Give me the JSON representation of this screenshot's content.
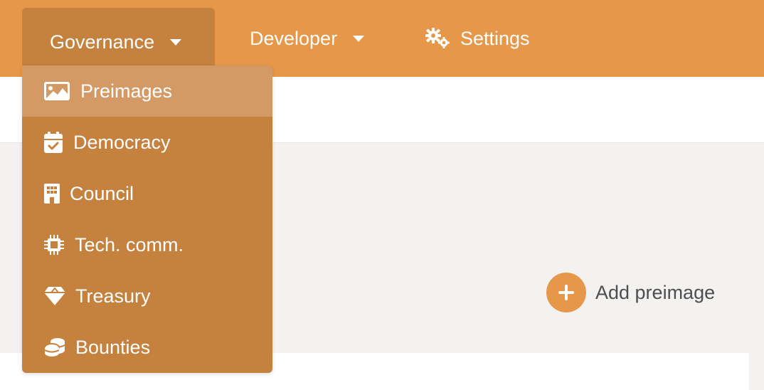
{
  "nav": {
    "governance_label": "Governance",
    "developer_label": "Developer",
    "settings_label": "Settings",
    "governance_menu": [
      {
        "label": "Preimages",
        "icon": "image-icon",
        "selected": true
      },
      {
        "label": "Democracy",
        "icon": "calendar-check-icon"
      },
      {
        "label": "Council",
        "icon": "building-icon"
      },
      {
        "label": "Tech. comm.",
        "icon": "microchip-icon"
      },
      {
        "label": "Treasury",
        "icon": "gem-icon"
      },
      {
        "label": "Bounties",
        "icon": "coins-icon"
      }
    ]
  },
  "main": {
    "add_preimage_label": "Add preimage",
    "add_icon": "plus-icon"
  },
  "colors": {
    "accent": "#e6974a",
    "menu_bg": "#c5813e",
    "menu_selected": "#d39a66",
    "page_bg": "#f3f2f1"
  }
}
